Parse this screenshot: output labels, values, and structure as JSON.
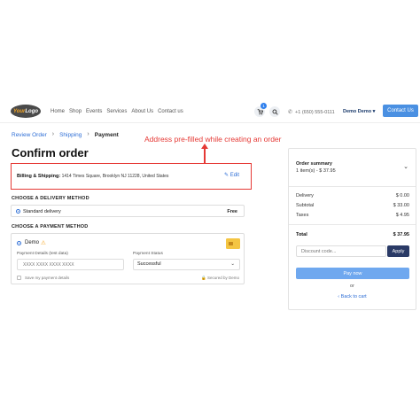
{
  "header": {
    "logo_text_your": "Your",
    "logo_text_logo": "Logo",
    "nav": [
      "Home",
      "Shop",
      "Events",
      "Services",
      "About Us",
      "Contact us"
    ],
    "cart_count": "1",
    "cart_icon": "cart-icon",
    "search_icon": "search-icon",
    "phone_icon": "phone-icon",
    "phone": "+1 (650) 555-0111",
    "user": "Demo Demo",
    "user_chevron": "▾",
    "contact_button": "Contact Us"
  },
  "breadcrumb": {
    "items": [
      "Review Order",
      "Shipping",
      "Payment"
    ],
    "separator": "›"
  },
  "page_title": "Confirm order",
  "annotation": "Address pre-filled while creating an order",
  "billing": {
    "label": "Billing & Shipping:",
    "address": "1414 Times Square, Brooklyn NJ 11228, United States",
    "edit_label": "Edit",
    "edit_icon": "✎"
  },
  "delivery": {
    "section_title": "CHOOSE A DELIVERY METHOD",
    "option": "Standard delivery",
    "price": "Free"
  },
  "payment": {
    "section_title": "CHOOSE A PAYMENT METHOD",
    "provider": "Demo",
    "warning_icon": "⚠",
    "details_label": "Payment Details (test data)",
    "card_placeholder": "XXXX XXXX XXXX XXXX",
    "status_label": "Payment Status",
    "status_value": "Successful",
    "save_label": "Save my payment details",
    "secured_label": "Secured by Demo",
    "lock_icon": "🔒"
  },
  "summary": {
    "title": "Order summary",
    "items": "1 item(s) -  $ 37.95",
    "chevron": "⌄",
    "rows": [
      {
        "label": "Delivery",
        "value": "$ 0.00"
      },
      {
        "label": "Subtotal",
        "value": "$ 33.00"
      },
      {
        "label": "Taxes",
        "value": "$ 4.95"
      }
    ],
    "total_label": "Total",
    "total_value": "$ 37.95",
    "discount_placeholder": "Discount code...",
    "apply_label": "Apply",
    "pay_label": "Pay now",
    "or_label": "or",
    "back_label": "‹  Back to cart"
  },
  "colors": {
    "accent": "#2f6fd6",
    "annotation": "#e53935",
    "apply_bg": "#2a3a66",
    "pay_bg": "#6fa8ef"
  }
}
